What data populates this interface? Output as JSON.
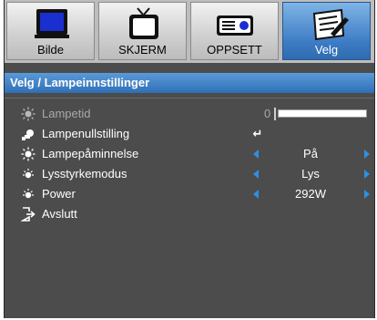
{
  "tabs": [
    {
      "label": "Bilde",
      "icon": "monitor-icon",
      "active": false
    },
    {
      "label": "SKJERM",
      "icon": "tv-icon",
      "active": false
    },
    {
      "label": "OPPSETT",
      "icon": "projector-icon",
      "active": false
    },
    {
      "label": "Velg",
      "icon": "notepad-icon",
      "active": true
    }
  ],
  "header": {
    "title": "Velg / Lampeinnstillinger"
  },
  "rows": [
    {
      "label": "Lampetid",
      "icon": "lamp-icon",
      "value": "0",
      "disabled": true
    },
    {
      "label": "Lampenullstilling",
      "icon": "reset-lamp-icon",
      "value": "↵"
    },
    {
      "label": "Lampepåminnelse",
      "icon": "lamp-icon",
      "value": "På"
    },
    {
      "label": "Lysstyrkemodus",
      "icon": "brightness-icon",
      "value": "Lys"
    },
    {
      "label": "Power",
      "icon": "brightness-icon",
      "value": "292W"
    },
    {
      "label": "Avslutt",
      "icon": "exit-icon"
    }
  ],
  "colors": {
    "accent": "#2f6fb6",
    "arrow": "#2f8fe0",
    "background": "#4c4c4c"
  }
}
